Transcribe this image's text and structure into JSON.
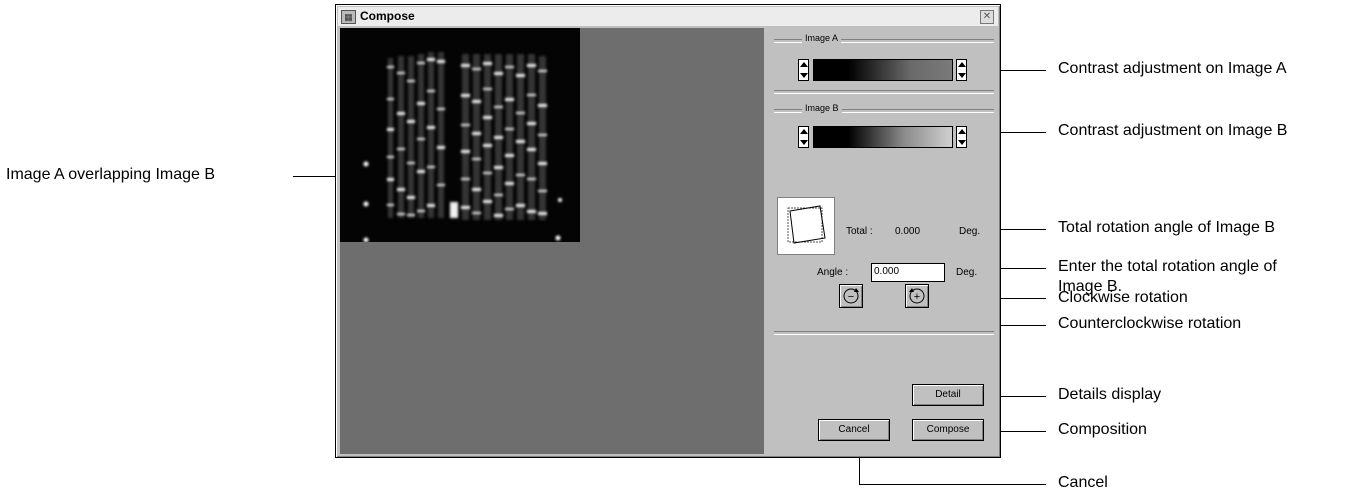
{
  "window": {
    "title": "Compose",
    "close_glyph": "✕",
    "icon_name": "app-icon"
  },
  "panel": {
    "image_a_label": "Image A",
    "image_b_label": "Image B",
    "total_label": "Total :",
    "total_value": "0.000",
    "total_unit": "Deg.",
    "angle_label": "Angle :",
    "angle_value": "0.000",
    "angle_unit": "Deg.",
    "ccw_symbol": "−",
    "cw_symbol": "+",
    "detail_label": "Detail",
    "cancel_label": "Cancel",
    "compose_label": "Compose"
  },
  "annotations": {
    "overlap": "Image A overlapping Image B",
    "contrast_a": "Contrast adjustment on Image A",
    "contrast_b": "Contrast adjustment on Image B",
    "total_rotation": "Total rotation angle of Image B",
    "enter_angle_line1": "Enter the total rotation angle of",
    "enter_angle_line2": "Image B.",
    "clockwise": "Clockwise rotation",
    "counterclockwise": "Counterclockwise rotation",
    "details": "Details display",
    "composition": "Composition",
    "cancel": "Cancel"
  },
  "colors": {
    "dialog": "#c0c0c0",
    "canvas": "#6e6e6e",
    "gel": "#040404"
  }
}
